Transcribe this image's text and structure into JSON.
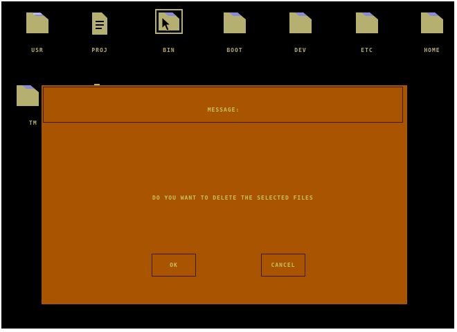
{
  "desktop": {
    "icons": [
      {
        "label": "USR",
        "icon": "folder-icon"
      },
      {
        "label": "PROJ",
        "icon": "document-icon"
      },
      {
        "label": "BIN",
        "icon": "folder-icon"
      },
      {
        "label": "BOOT",
        "icon": "folder-icon"
      },
      {
        "label": "DEV",
        "icon": "folder-icon"
      },
      {
        "label": "ETC",
        "icon": "folder-icon"
      },
      {
        "label": "HOME",
        "icon": "folder-icon"
      },
      {
        "label": "TM",
        "icon": "folder-icon"
      }
    ]
  },
  "dialog": {
    "title": "MESSAGE:",
    "message": "DO YOU WANT TO DELETE THE SELECTED FILES",
    "ok_label": "OK",
    "cancel_label": "CANCEL"
  },
  "colors": {
    "background": "#000000",
    "icon_fill": "#b5b070",
    "icon_stripe": "#8a8ad8",
    "dialog_bg": "#a85400",
    "dialog_text": "#c8c25e",
    "dialog_border": "#3a1a00"
  }
}
